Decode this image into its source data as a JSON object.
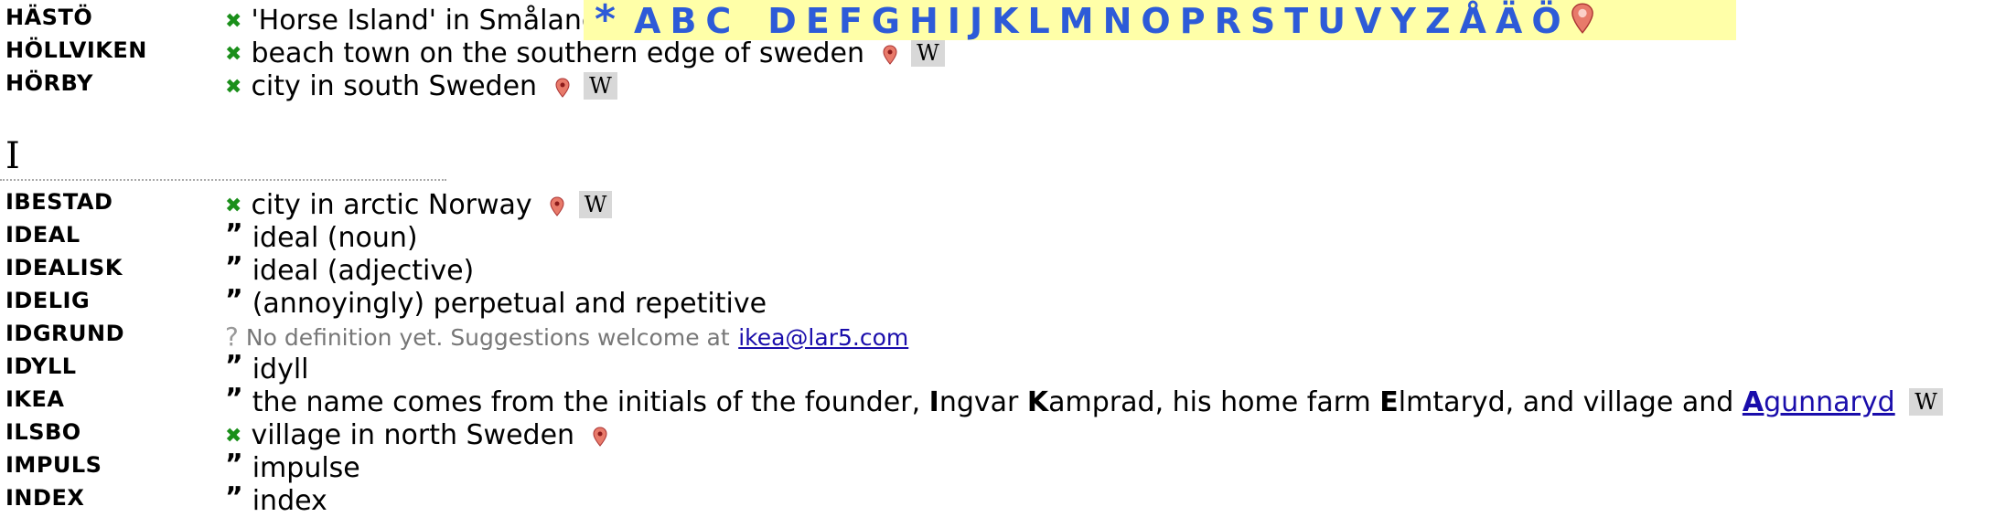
{
  "alphabet": {
    "star": "*",
    "letters": [
      "A",
      "B",
      "C",
      "D",
      "E",
      "F",
      "G",
      "H",
      "I",
      "J",
      "K",
      "L",
      "M",
      "N",
      "O",
      "P",
      "R",
      "S",
      "T",
      "U",
      "V",
      "Y",
      "Z",
      "Å",
      "Ä",
      "Ö"
    ]
  },
  "section": {
    "letter": "I"
  },
  "rows_top": [
    {
      "term": "HÄSTÖ",
      "mark": "x",
      "text": "'Horse Island' in Småland",
      "pin": false,
      "wiki": false
    },
    {
      "term": "HÖLLVIKEN",
      "mark": "x",
      "text": "beach town on the southern edge of sweden",
      "pin": true,
      "wiki": true
    },
    {
      "term": "HÖRBY",
      "mark": "x",
      "text": "city in south Sweden",
      "pin": true,
      "wiki": true
    }
  ],
  "wiki_label": "W",
  "rows": {
    "ibestad": {
      "term": "IBESTAD",
      "text": "city in arctic Norway"
    },
    "ideal": {
      "term": "IDEAL",
      "text": "ideal (noun)"
    },
    "idealisk": {
      "term": "IDEALISK",
      "text": "ideal (adjective)"
    },
    "idelig": {
      "term": "IDELIG",
      "text": "(annoyingly) perpetual and repetitive"
    },
    "idgrund": {
      "term": "IDGRUND",
      "text": "No definition yet. Suggestions welcome at",
      "email": "ikea@lar5.com"
    },
    "idyll": {
      "term": "IDYLL",
      "text": "idyll"
    },
    "ikea": {
      "term": "IKEA",
      "pre": "the name comes from the initials of the founder,",
      "i_bold": "I",
      "i_rest": "ngvar",
      "k_bold": "K",
      "k_rest": "amprad, his home farm",
      "e_bold": "E",
      "e_rest": "lmtaryd, and village and",
      "a_bold": "A",
      "a_rest": "gunnaryd"
    },
    "ilsbo": {
      "term": "ILSBO",
      "text": "village in north Sweden"
    },
    "impuls": {
      "term": "IMPULS",
      "text": "impulse"
    },
    "index": {
      "term": "INDEX",
      "text": "index"
    }
  },
  "marks": {
    "x": "✖",
    "quote": "”",
    "unknown": "?"
  },
  "colors": {
    "alpha_bg": "#ffffa8",
    "alpha_text": "#2d5bd8",
    "mark_green": "#1a8f1a",
    "link": "#1a0dab"
  }
}
